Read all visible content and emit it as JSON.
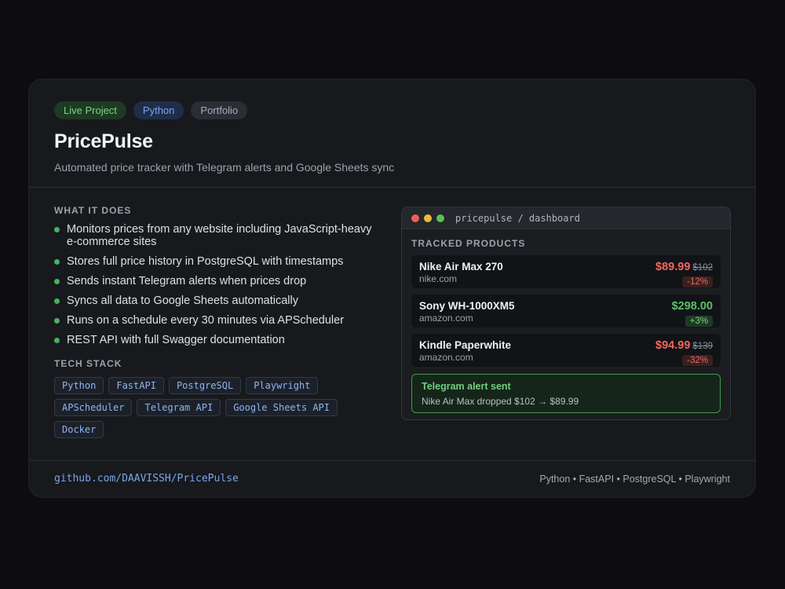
{
  "badges": [
    "Live Project",
    "Python",
    "Portfolio"
  ],
  "title": "PricePulse",
  "subtitle": "Automated price tracker with Telegram alerts and Google Sheets sync",
  "what_it_does": {
    "label": "WHAT IT DOES",
    "items": [
      "Monitors prices from any website including JavaScript-heavy e-commerce sites",
      "Stores full price history in PostgreSQL with timestamps",
      "Sends instant Telegram alerts when prices drop",
      "Syncs all data to Google Sheets automatically",
      "Runs on a schedule every 30 minutes via APScheduler",
      "REST API with full Swagger documentation"
    ]
  },
  "tech_stack": {
    "label": "TECH STACK",
    "tags": [
      "Python",
      "FastAPI",
      "PostgreSQL",
      "Playwright",
      "APScheduler",
      "Telegram API",
      "Google Sheets API",
      "Docker"
    ]
  },
  "dashboard": {
    "window_title": "pricepulse / dashboard",
    "section_label": "TRACKED PRODUCTS",
    "products": [
      {
        "name": "Nike Air Max 270",
        "site": "nike.com",
        "price": "$89.99",
        "old_price": "$102",
        "change": "-12%",
        "direction": "down"
      },
      {
        "name": "Sony WH-1000XM5",
        "site": "amazon.com",
        "price": "$298.00",
        "old_price": "",
        "change": "+3%",
        "direction": "up"
      },
      {
        "name": "Kindle Paperwhite",
        "site": "amazon.com",
        "price": "$94.99",
        "old_price": "$139",
        "change": "-32%",
        "direction": "down"
      }
    ],
    "alert": {
      "title": "Telegram alert sent",
      "text": "Nike Air Max dropped $102 → $89.99"
    }
  },
  "footer": {
    "repo": "github.com/DAAVISSH/PricePulse",
    "stack": "Python • FastAPI • PostgreSQL • Playwright"
  },
  "colors": {
    "accent_green": "#4cb05a",
    "accent_blue": "#79a6ea",
    "price_down": "#f0675c",
    "price_up": "#58c163"
  }
}
